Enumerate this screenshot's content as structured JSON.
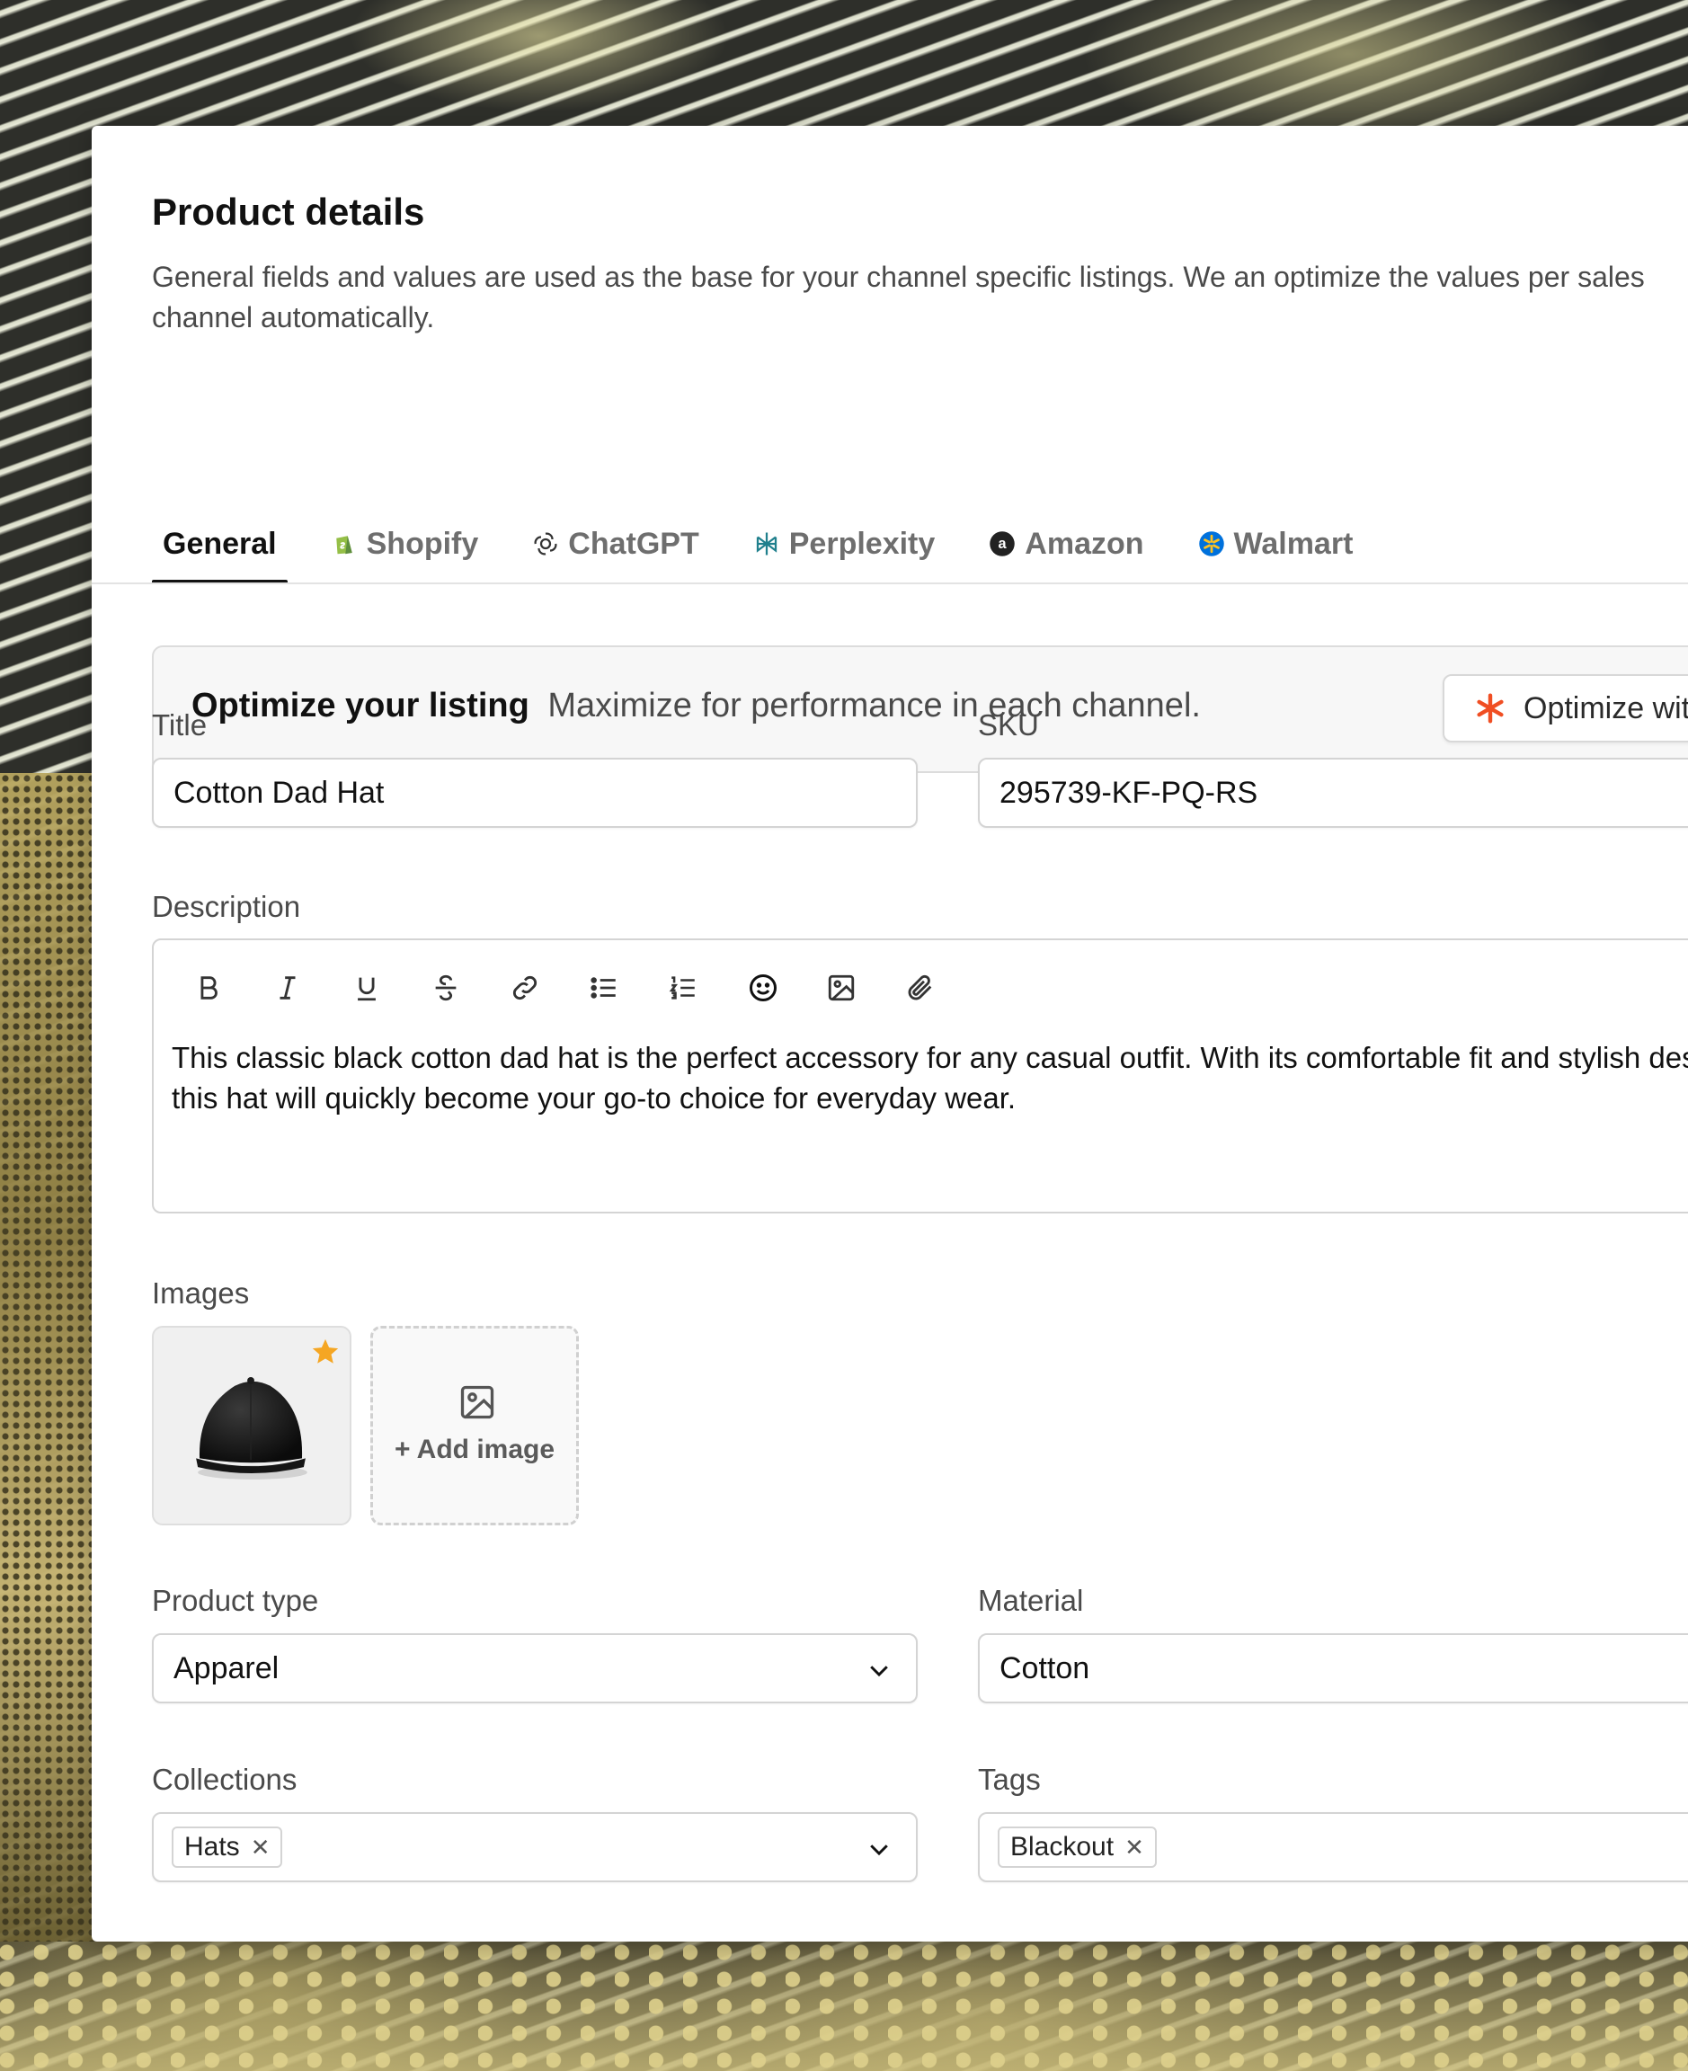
{
  "page": {
    "title": "Product details",
    "description": "General fields and values are used as the base for your channel specific listings. We an optimize the values per sales channel automatically."
  },
  "tabs": [
    {
      "label": "General",
      "icon": "none",
      "active": true
    },
    {
      "label": "Shopify",
      "icon": "shopify-icon",
      "active": false
    },
    {
      "label": "ChatGPT",
      "icon": "chatgpt-icon",
      "active": false
    },
    {
      "label": "Perplexity",
      "icon": "perplexity-icon",
      "active": false
    },
    {
      "label": "Amazon",
      "icon": "amazon-icon",
      "active": false
    },
    {
      "label": "Walmart",
      "icon": "walmart-icon",
      "active": false
    }
  ],
  "banner": {
    "title": "Optimize your listing",
    "subtitle": "Maximize for performance in each channel.",
    "button_label": "Optimize with AI",
    "accent": "#f04e23"
  },
  "form": {
    "title": {
      "label": "Title",
      "value": "Cotton Dad Hat"
    },
    "sku": {
      "label": "SKU",
      "value": "295739-KF-PQ-RS"
    },
    "description": {
      "label": "Description",
      "toolbar": [
        "bold-icon",
        "italic-icon",
        "underline-icon",
        "strikethrough-icon",
        "link-icon",
        "bullet-list-icon",
        "numbered-list-icon",
        "emoji-icon",
        "image-icon",
        "attachment-icon"
      ],
      "text": "This classic black cotton dad hat is the perfect accessory for any casual outfit. With its comfortable fit and stylish design, this hat will quickly become your go-to choice for everyday wear."
    },
    "images": {
      "label": "Images",
      "add_label": "+ Add image"
    },
    "product_type": {
      "label": "Product type",
      "value": "Apparel"
    },
    "material": {
      "label": "Material",
      "value": "Cotton"
    },
    "collections": {
      "label": "Collections",
      "chips": [
        "Hats"
      ]
    },
    "tags": {
      "label": "Tags",
      "chips": [
        "Blackout"
      ]
    }
  },
  "colors": {
    "star": "#f5a623",
    "shopify": "#5e8e3e",
    "perplexity": "#20808d",
    "walmart": "#0071dc",
    "text_primary": "#111111"
  }
}
